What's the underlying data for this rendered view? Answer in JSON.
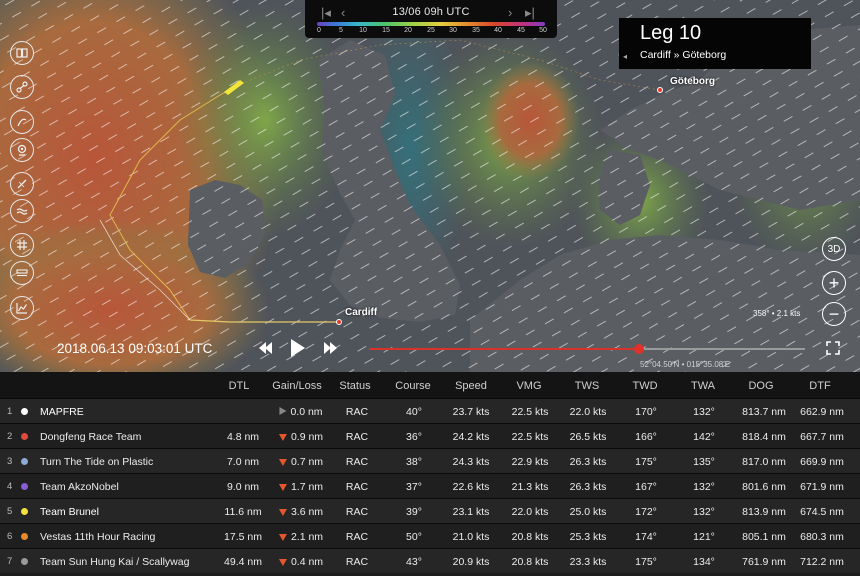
{
  "timeline": {
    "time_label": "13/06 09h UTC",
    "scale_ticks": [
      "0",
      "5",
      "10",
      "15",
      "20",
      "25",
      "30",
      "35",
      "40",
      "45",
      "50"
    ]
  },
  "leg": {
    "title": "Leg 10",
    "route": "Cardiff » Göteborg"
  },
  "map": {
    "cities": {
      "cardiff": "Cardiff",
      "goteborg": "Göteborg"
    },
    "heading_readout": "358° • 2.1 kts",
    "coords_readout": "52°04.50'N • 015°35.08'E",
    "btn_3d": "3D",
    "btn_zoom_in": "+",
    "btn_zoom_out": "−"
  },
  "playback": {
    "datetime": "2018.06.13 09:03:01 UTC",
    "progress": 0.62
  },
  "icons": {
    "tools": [
      "book-icon",
      "route-icon",
      "wind-icon",
      "location-icon",
      "compass-icon",
      "waves-icon",
      "grid-icon",
      "layers-icon",
      "chart-icon"
    ]
  },
  "table": {
    "headers": {
      "dtl": "DTL",
      "gain": "Gain/Loss",
      "status": "Status",
      "course": "Course",
      "speed": "Speed",
      "vmg": "VMG",
      "tws": "TWS",
      "twd": "TWD",
      "twa": "TWA",
      "dog": "DOG",
      "dtf": "DTF"
    },
    "rows": [
      {
        "rank": "1",
        "color": "#ffffff",
        "name": "MAPFRE",
        "dtl": "",
        "gain": "0.0 nm",
        "trend": "neutral",
        "status": "RAC",
        "course": "40°",
        "speed": "23.7 kts",
        "vmg": "22.5 kts",
        "tws": "22.0 kts",
        "twd": "170°",
        "twa": "132°",
        "dog": "813.7 nm",
        "dtf": "662.9 nm"
      },
      {
        "rank": "2",
        "color": "#e04a3c",
        "name": "Dongfeng Race Team",
        "dtl": "4.8 nm",
        "gain": "0.9 nm",
        "trend": "down",
        "status": "RAC",
        "course": "36°",
        "speed": "24.2 kts",
        "vmg": "22.5 kts",
        "tws": "26.5 kts",
        "twd": "166°",
        "twa": "142°",
        "dog": "818.4 nm",
        "dtf": "667.7 nm"
      },
      {
        "rank": "3",
        "color": "#8fa8d8",
        "name": "Turn The Tide on Plastic",
        "dtl": "7.0 nm",
        "gain": "0.7 nm",
        "trend": "down",
        "status": "RAC",
        "course": "38°",
        "speed": "24.3 kts",
        "vmg": "22.9 kts",
        "tws": "26.3 kts",
        "twd": "175°",
        "twa": "135°",
        "dog": "817.0 nm",
        "dtf": "669.9 nm"
      },
      {
        "rank": "4",
        "color": "#8a5bd6",
        "name": "Team AkzoNobel",
        "dtl": "9.0 nm",
        "gain": "1.7 nm",
        "trend": "down",
        "status": "RAC",
        "course": "37°",
        "speed": "22.6 kts",
        "vmg": "21.3 kts",
        "tws": "26.3 kts",
        "twd": "167°",
        "twa": "132°",
        "dog": "801.6 nm",
        "dtf": "671.9 nm"
      },
      {
        "rank": "5",
        "color": "#f2e23a",
        "name": "Team Brunel",
        "dtl": "11.6 nm",
        "gain": "3.6 nm",
        "trend": "down",
        "status": "RAC",
        "course": "39°",
        "speed": "23.1 kts",
        "vmg": "22.0 kts",
        "tws": "25.0 kts",
        "twd": "172°",
        "twa": "132°",
        "dog": "813.9 nm",
        "dtf": "674.5 nm"
      },
      {
        "rank": "6",
        "color": "#e88a2c",
        "name": "Vestas 11th Hour Racing",
        "dtl": "17.5 nm",
        "gain": "2.1 nm",
        "trend": "down",
        "status": "RAC",
        "course": "50°",
        "speed": "21.0 kts",
        "vmg": "20.8 kts",
        "tws": "25.3 kts",
        "twd": "174°",
        "twa": "121°",
        "dog": "805.1 nm",
        "dtf": "680.3 nm"
      },
      {
        "rank": "7",
        "color": "#9a9a9a",
        "name": "Team Sun Hung Kai / Scallywag",
        "dtl": "49.4 nm",
        "gain": "0.4 nm",
        "trend": "down",
        "status": "RAC",
        "course": "43°",
        "speed": "20.9 kts",
        "vmg": "20.8 kts",
        "tws": "23.3 kts",
        "twd": "175°",
        "twa": "134°",
        "dog": "761.9 nm",
        "dtf": "712.2 nm"
      }
    ]
  }
}
